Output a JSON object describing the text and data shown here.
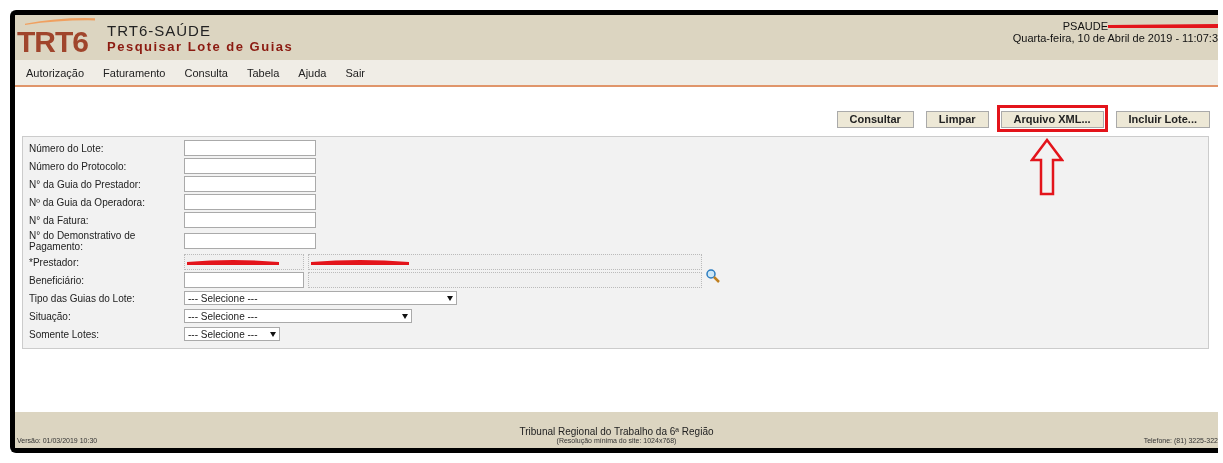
{
  "header": {
    "logo": "TRT6",
    "app_name": "TRT6-SAÚDE",
    "page_title": "Pesquisar Lote de Guias",
    "user": "PSAUDE",
    "user_redacted": true,
    "datetime": "Quarta-feira, 10 de Abril de 2019 - 11:07:3"
  },
  "menu": [
    "Autorização",
    "Faturamento",
    "Consulta",
    "Tabela",
    "Ajuda",
    "Sair"
  ],
  "actions": [
    {
      "label": "Consultar",
      "highlighted": false
    },
    {
      "label": "Limpar",
      "highlighted": false
    },
    {
      "label": "Arquivo XML...",
      "highlighted": true
    },
    {
      "label": "Incluir Lote...",
      "highlighted": false
    }
  ],
  "form": {
    "fields": [
      {
        "label": "Número do Lote:",
        "kind": "text"
      },
      {
        "label": "Número do Protocolo:",
        "kind": "text"
      },
      {
        "label": "N° da Guia do Prestador:",
        "kind": "text"
      },
      {
        "label": "Nº da Guia da Operadora:",
        "kind": "text"
      },
      {
        "label": "N° da Fatura:",
        "kind": "text"
      },
      {
        "label": "N° do Demonstrativo de Pagamento:",
        "kind": "text"
      },
      {
        "label": "*Prestador:",
        "kind": "pair",
        "disabled": true,
        "redacted": true
      },
      {
        "label": "Beneficiário:",
        "kind": "lookup",
        "disabled": false,
        "redacted": false
      },
      {
        "label": "Tipo das Guias do Lote:",
        "kind": "select",
        "value": "--- Selecione ---"
      },
      {
        "label": "Situação:",
        "kind": "select",
        "value": "--- Selecione ---"
      },
      {
        "label": "Somente Lotes:",
        "kind": "select",
        "value": "--- Selecione ---"
      }
    ]
  },
  "footer": {
    "version": "Versão: 01/03/2019 10:30",
    "org": "Tribunal Regional do Trabalho da 6ª Região",
    "resolution": "(Resolução mínima do site: 1024x768)",
    "phone": "Telefone: (81) 3225-322"
  }
}
